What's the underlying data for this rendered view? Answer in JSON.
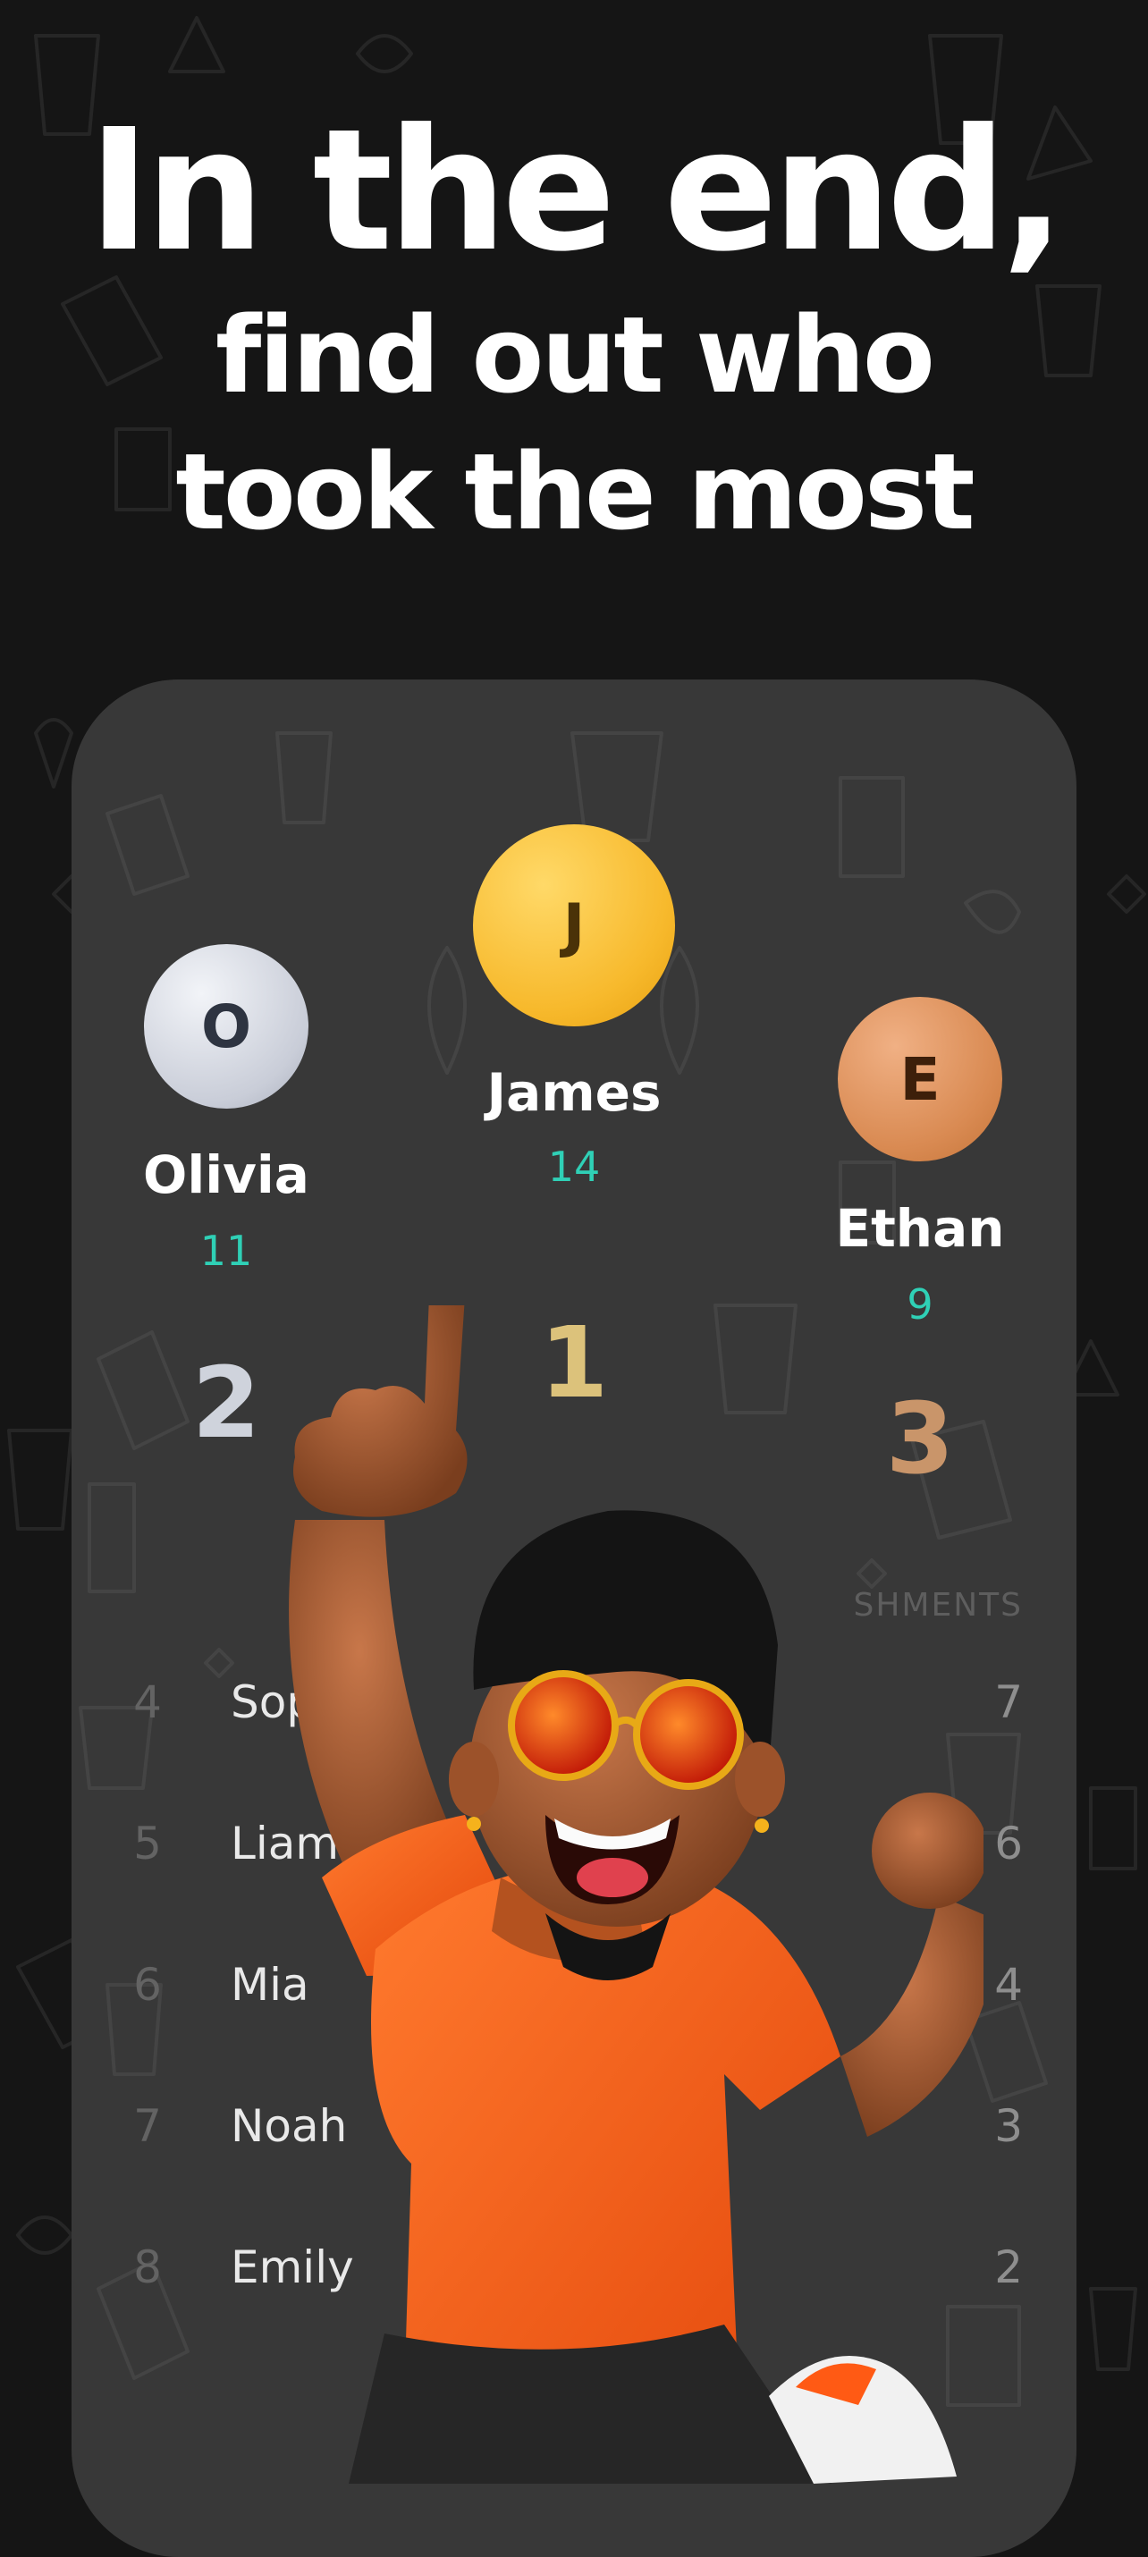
{
  "headline": {
    "line1": "In the end,",
    "line2": "find out who",
    "line3": "took the most"
  },
  "podium": [
    {
      "position": "second",
      "initial": "O",
      "name": "Olivia",
      "score": "11",
      "rank": "2",
      "avatar_color": "#d9dde6",
      "rank_color": "#cfd3dc"
    },
    {
      "position": "first",
      "initial": "J",
      "name": "James",
      "score": "14",
      "rank": "1",
      "avatar_color": "#f7b92c",
      "rank_color": "#dcc27b"
    },
    {
      "position": "third",
      "initial": "E",
      "name": "Ethan",
      "score": "9",
      "rank": "3",
      "avatar_color": "#d98a52",
      "rank_color": "#c9956a"
    }
  ],
  "list_header": "SHMENTS",
  "leaderboard": [
    {
      "rank": "4",
      "name": "Sop",
      "count": "7"
    },
    {
      "rank": "5",
      "name": "Liam",
      "count": "6"
    },
    {
      "rank": "6",
      "name": "Mia",
      "count": "4"
    },
    {
      "rank": "7",
      "name": "Noah",
      "count": "3"
    },
    {
      "rank": "8",
      "name": "Emily",
      "count": "2"
    }
  ],
  "colors": {
    "background": "#151515",
    "card": "#383838",
    "score_teal": "#2fd0b6"
  }
}
